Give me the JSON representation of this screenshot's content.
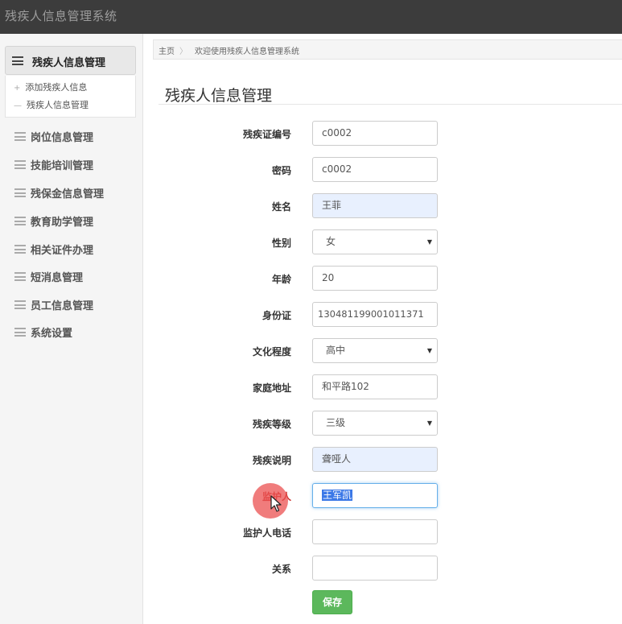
{
  "app": {
    "title": "残疾人信息管理系统"
  },
  "sidebar": {
    "active": {
      "label": "残疾人信息管理"
    },
    "subitems": [
      {
        "marker": "+",
        "label": "添加残疾人信息"
      },
      {
        "marker": "—",
        "label": "残疾人信息管理"
      }
    ],
    "items": [
      {
        "label": "岗位信息管理"
      },
      {
        "label": "技能培训管理"
      },
      {
        "label": "残保金信息管理"
      },
      {
        "label": "教育助学管理"
      },
      {
        "label": "相关证件办理"
      },
      {
        "label": "短消息管理"
      },
      {
        "label": "员工信息管理"
      },
      {
        "label": "系统设置"
      }
    ]
  },
  "breadcrumb": {
    "home": "主页",
    "separator": "〉",
    "current": "欢迎使用残疾人信息管理系统"
  },
  "page": {
    "title": "残疾人信息管理"
  },
  "form": {
    "fields": [
      {
        "label": "残疾证编号",
        "value": "c0002"
      },
      {
        "label": "密码",
        "value": "c0002"
      },
      {
        "label": "姓名",
        "value": "王菲"
      },
      {
        "label": "性别",
        "value": "女"
      },
      {
        "label": "年龄",
        "value": "20"
      },
      {
        "label": "身份证",
        "value": "130481199001011371"
      },
      {
        "label": "文化程度",
        "value": "高中"
      },
      {
        "label": "家庭地址",
        "value": "和平路102"
      },
      {
        "label": "残疾等级",
        "value": "三级"
      },
      {
        "label": "残疾说明",
        "value": "聋哑人"
      },
      {
        "label": "监护人",
        "value": "王军凯"
      },
      {
        "label": "监护人电话",
        "value": ""
      },
      {
        "label": "关系",
        "value": ""
      }
    ],
    "save_label": "保存"
  },
  "icons": {
    "menu": "menu-icon",
    "dropdown": "caret-down-icon",
    "pointer": "mouse-pointer-icon"
  },
  "colors": {
    "topbar": "#3c3c3c",
    "save_button": "#5cb85c",
    "autofill": "#e8f0fe",
    "focus": "#66afe9"
  }
}
